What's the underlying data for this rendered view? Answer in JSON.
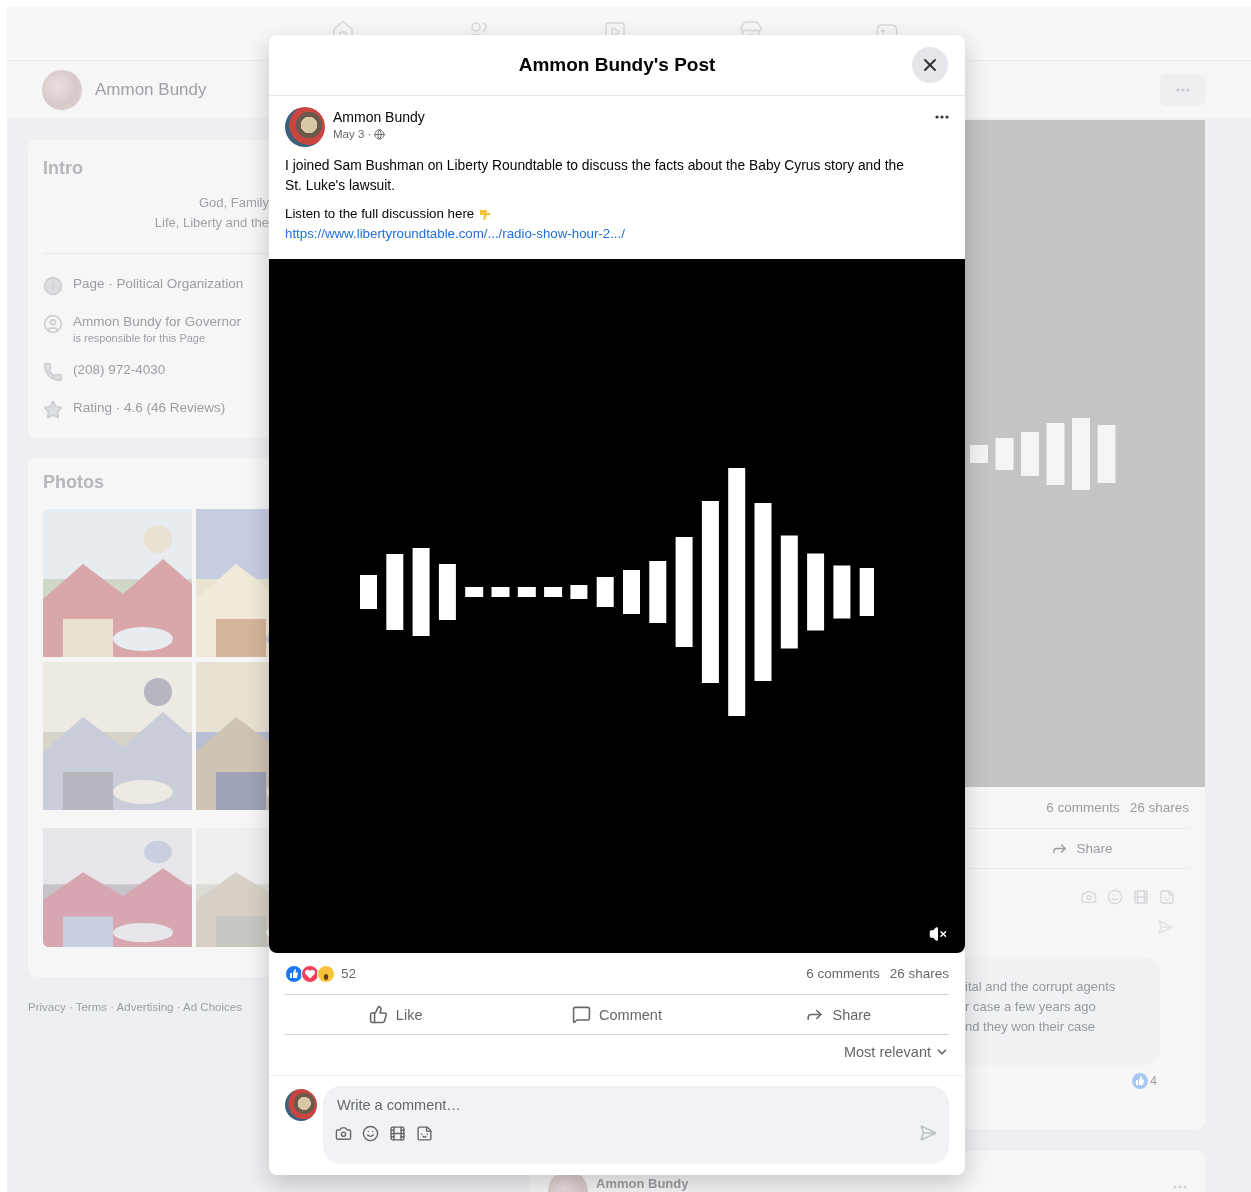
{
  "page_header": {
    "name": "Ammon Bundy"
  },
  "intro": {
    "title": "Intro",
    "bio": [
      "God, Family",
      "Life, Liberty and the"
    ],
    "details": [
      {
        "kind": "info",
        "text": "Page · Political Organization"
      },
      {
        "kind": "admin",
        "text": "Ammon Bundy for Governor",
        "subtext": "is responsible for this Page"
      },
      {
        "kind": "phone",
        "text": "(208) 972-4030"
      },
      {
        "kind": "rating",
        "text": "Rating · 4.6 (46 Reviews)"
      }
    ]
  },
  "photos": {
    "title": "Photos"
  },
  "footer": "Privacy · Terms · Advertising · Ad Choices",
  "feed_post": {
    "comments": "6 comments",
    "shares": "26 shares",
    "action": "Share",
    "comment_lines": [
      "ital and the corrupt agents",
      "r case a few years ago",
      "nd they won their case"
    ],
    "comment_reactions": "4"
  },
  "next_post": {
    "author": "Ammon Bundy"
  },
  "dialog": {
    "title": "Ammon Bundy's Post",
    "post": {
      "author": "Ammon Bundy",
      "date": "May 3 ·",
      "paragraphs": [
        "I joined Sam Bushman on Liberty Roundtable to discuss the facts about the Baby Cyrus story and the St. Luke's lawsuit.",
        "Listen to the full discussion here"
      ],
      "link": "https://www.libertyroundtable.com/.../radio-show-hour-2.../"
    },
    "reactions_count": "52",
    "comments": "6 comments",
    "shares": "26 shares",
    "actions": [
      {
        "kind": "like",
        "label": "Like"
      },
      {
        "kind": "comment",
        "label": "Comment"
      },
      {
        "kind": "share",
        "label": "Share"
      }
    ],
    "sort": "Most relevant",
    "composer": {
      "placeholder": "Write a comment…"
    }
  }
}
